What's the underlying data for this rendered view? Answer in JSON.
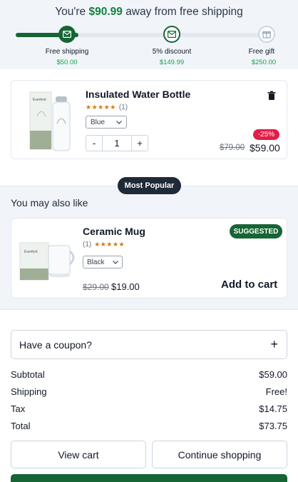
{
  "shipping": {
    "prefix": "You're",
    "amount": "$90.99",
    "suffix": "away from free shipping",
    "progress": 0.25,
    "milestones": [
      {
        "label": "Free shipping",
        "price": "$50.00",
        "icon": "mail-icon",
        "reached": true
      },
      {
        "label": "5% discount",
        "price": "$149.99",
        "icon": "mail-icon",
        "reached": false
      },
      {
        "label": "Free gift",
        "price": "$250.00",
        "icon": "gift-icon",
        "reached": false
      }
    ]
  },
  "cart_item": {
    "name": "Insulated Water Bottle",
    "stars": "★★★★★",
    "review_count": "(1)",
    "variant": "Blue",
    "quantity": "1",
    "qty_minus": "-",
    "qty_plus": "+",
    "discount": "-25%",
    "old_price": "$79.00",
    "new_price": "$59.00",
    "image_label": "Everfont"
  },
  "upsell": {
    "badge": "Most Popular",
    "heading": "You may also like",
    "product": {
      "name": "Ceramic Mug",
      "badge": "SUGGESTED",
      "review_count": "(1)",
      "stars": "★★★★★",
      "variant": "Black",
      "old_price": "$29.00",
      "new_price": "$19.00",
      "add_label": "Add to cart",
      "image_label": "Everfont"
    }
  },
  "summary": {
    "coupon_label": "Have a coupon?",
    "coupon_icon": "+",
    "rows": [
      {
        "label": "Subtotal",
        "value": "$59.00"
      },
      {
        "label": "Shipping",
        "value": "Free!"
      },
      {
        "label": "Tax",
        "value": "$14.75"
      },
      {
        "label": "Total",
        "value": "$73.75"
      }
    ],
    "view_cart": "View cart",
    "continue": "Continue shopping"
  },
  "colors": {
    "accent": "#166534",
    "accent_text": "#16a34a",
    "discount": "#e11d48",
    "star": "#d97706"
  }
}
